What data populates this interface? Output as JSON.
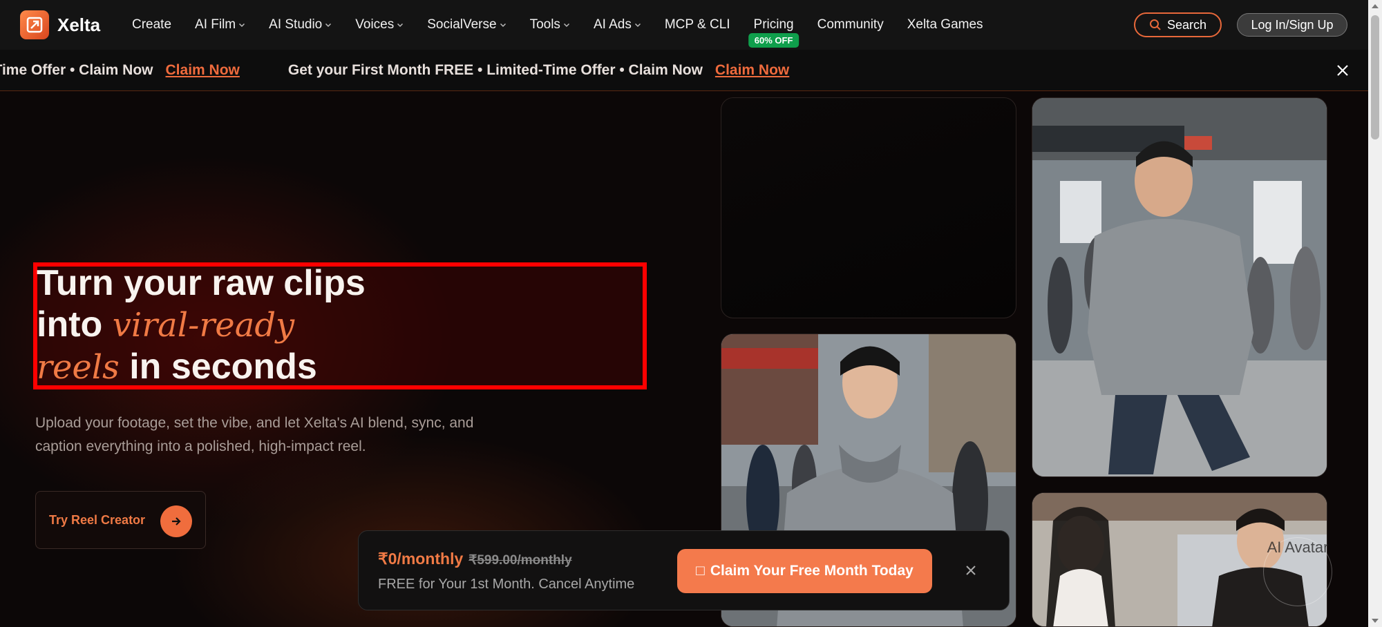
{
  "brand": {
    "name": "Xelta"
  },
  "nav": {
    "items": [
      {
        "label": "Create",
        "dropdown": false
      },
      {
        "label": "AI Film",
        "dropdown": true
      },
      {
        "label": "AI Studio",
        "dropdown": true
      },
      {
        "label": "Voices",
        "dropdown": true
      },
      {
        "label": "SocialVerse",
        "dropdown": true
      },
      {
        "label": "Tools",
        "dropdown": true
      },
      {
        "label": "AI Ads",
        "dropdown": true
      },
      {
        "label": "MCP & CLI",
        "dropdown": false
      },
      {
        "label": "Pricing",
        "dropdown": false,
        "badge": "60% OFF"
      },
      {
        "label": "Community",
        "dropdown": false
      },
      {
        "label": "Xelta Games",
        "dropdown": false
      }
    ],
    "search_label": "Search",
    "login_label": "Log In/Sign Up"
  },
  "promo": {
    "partial_text": "ted-Time Offer • Claim Now",
    "text": "Get your First Month FREE • Limited-Time Offer • Claim Now",
    "link": "Claim Now"
  },
  "hero": {
    "line1": "Turn your raw clips",
    "line2_prefix": "into ",
    "line2_italic": "viral-ready",
    "line3_italic": "reels",
    "line3_suffix": " in seconds",
    "subtext": "Upload your footage, set the vibe, and let Xelta's AI blend, sync, and caption everything into a polished, high-impact reel.",
    "cta_label": "Try Reel Creator"
  },
  "avatar_widget": {
    "label": "AI Avatar"
  },
  "offer": {
    "price_now": "₹0/monthly",
    "price_old": "₹599.00/monthly",
    "note": "FREE for Your 1st Month. Cancel Anytime",
    "button_label": "Claim Your Free Month Today",
    "button_glyph": "□"
  },
  "colors": {
    "accent": "#f07a45",
    "highlight_box": "#ff0000",
    "badge": "#0f9f4c"
  }
}
